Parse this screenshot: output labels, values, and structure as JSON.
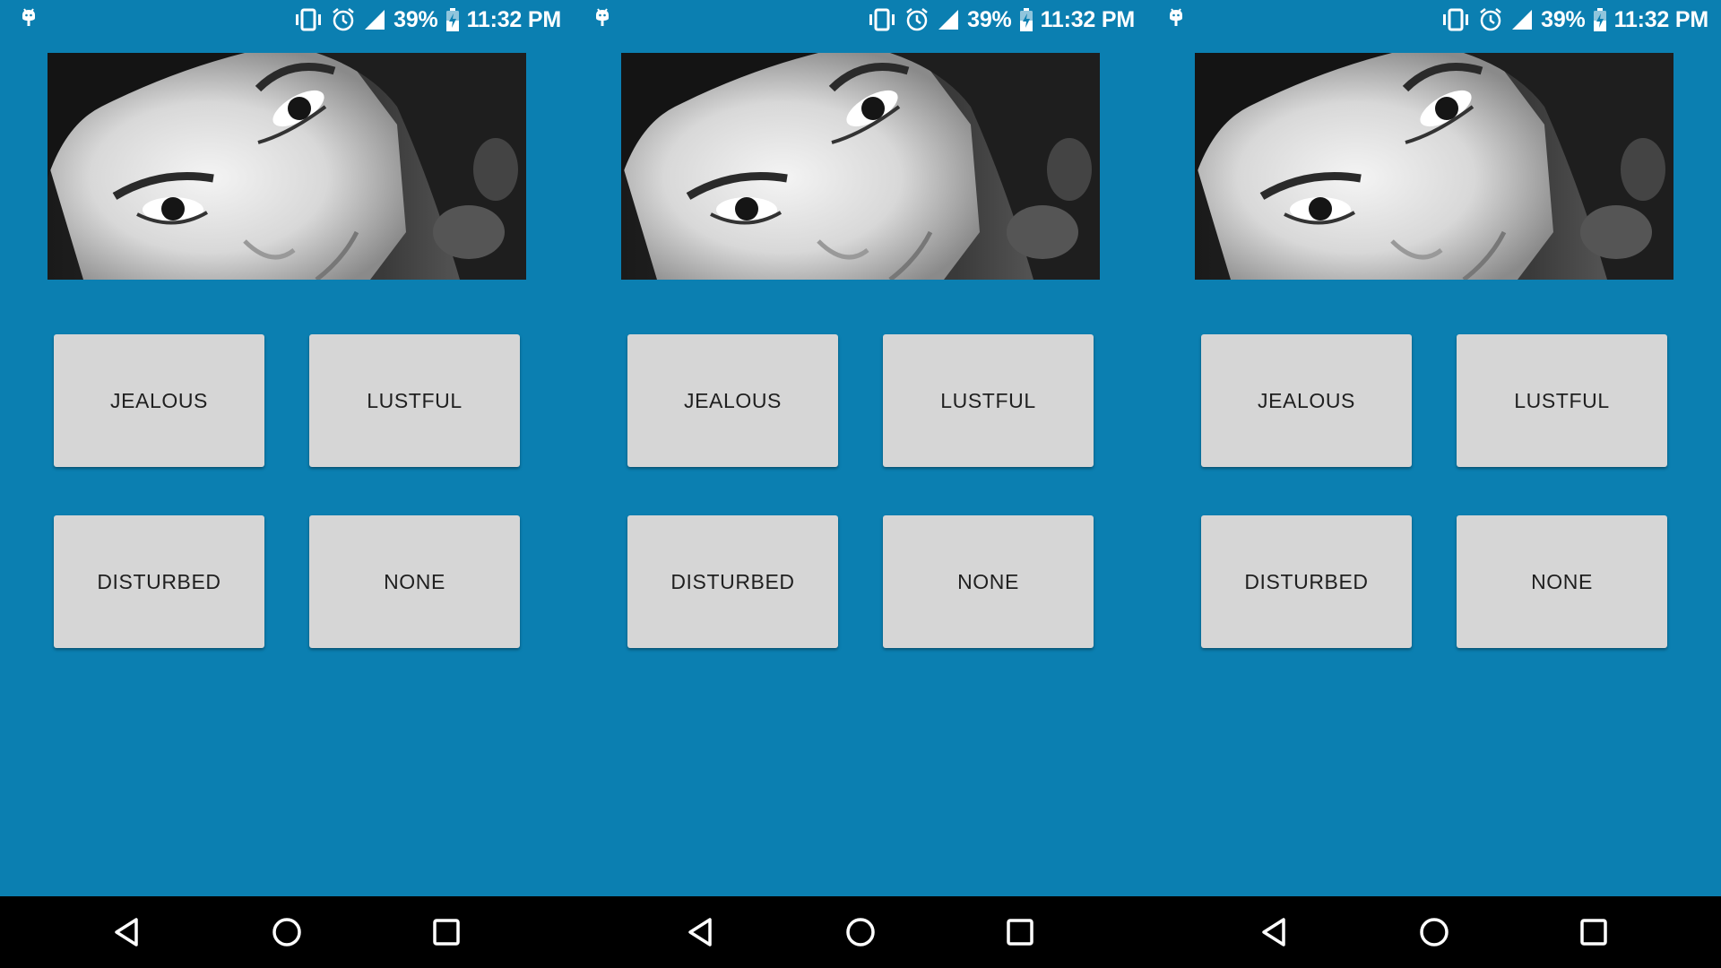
{
  "status_bar": {
    "notification_icon": "android-debug-icon",
    "vibrate_icon": "vibrate-icon",
    "alarm_icon": "alarm-clock-icon",
    "signal_icon": "cell-signal-icon",
    "battery_percent": "39%",
    "battery_icon": "battery-charging-icon",
    "time": "11:32 PM"
  },
  "photo": {
    "description_icon": "grayscale-face-photo"
  },
  "buttons": {
    "jealous": "JEALOUS",
    "lustful": "LUSTFUL",
    "disturbed": "DISTURBED",
    "none": "NONE"
  },
  "nav_bar": {
    "back_icon": "back-triangle-icon",
    "home_icon": "home-circle-icon",
    "recents_icon": "recents-square-icon"
  },
  "colors": {
    "background": "#0b7fb1",
    "button": "#d6d6d6",
    "nav_bar": "#000000",
    "status_text": "#ffffff"
  }
}
